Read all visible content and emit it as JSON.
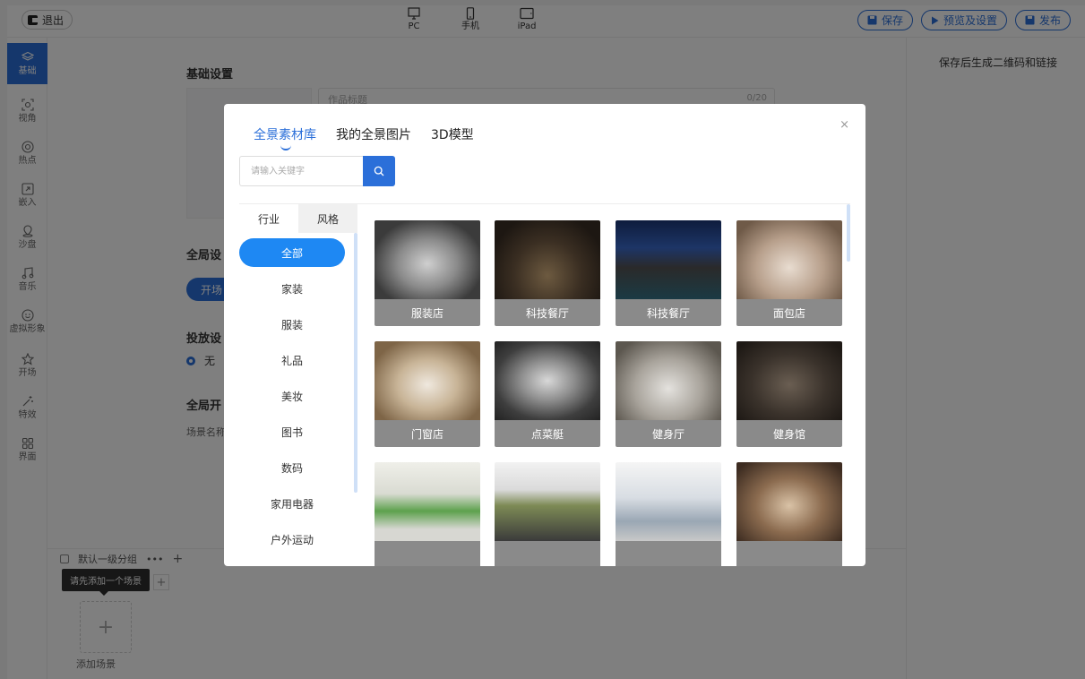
{
  "topbar": {
    "exit_label": "退出",
    "devices": [
      {
        "label": "PC"
      },
      {
        "label": "手机"
      },
      {
        "label": "iPad"
      }
    ],
    "save_label": "保存",
    "preview_label": "预览及设置",
    "publish_label": "发布"
  },
  "sidebar": {
    "items": [
      {
        "label": "基础",
        "icon": "layers-icon"
      },
      {
        "label": "视角",
        "icon": "view-angle-icon"
      },
      {
        "label": "热点",
        "icon": "hotspot-icon"
      },
      {
        "label": "嵌入",
        "icon": "embed-icon"
      },
      {
        "label": "沙盘",
        "icon": "map-pin-icon"
      },
      {
        "label": "音乐",
        "icon": "music-icon"
      },
      {
        "label": "虚拟形象",
        "icon": "avatar-icon"
      },
      {
        "label": "开场",
        "icon": "star-icon"
      },
      {
        "label": "特效",
        "icon": "magic-wand-icon"
      },
      {
        "label": "界面",
        "icon": "grid-icon"
      }
    ]
  },
  "main": {
    "basic_settings_title": "基础设置",
    "title_placeholder": "作品标题",
    "title_count": "0/20",
    "global_settings_title": "全局设",
    "open_button_label": "开场",
    "placement_title": "投放设",
    "radio_none_label": "无",
    "global_open_title": "全局开",
    "scene_name_label": "场景名称"
  },
  "right_panel": {
    "note": "保存后生成二维码和链接"
  },
  "bottom": {
    "group_name": "默认一级分组",
    "group_more": "•••",
    "group_add": "+",
    "tooltip": "请先添加一个场景",
    "tooltip_add": "+",
    "add_scene_plus": "+",
    "add_scene_label": "添加场景"
  },
  "modal": {
    "close": "×",
    "tabs": [
      {
        "label": "全景素材库",
        "active": true
      },
      {
        "label": "我的全景图片",
        "active": false
      },
      {
        "label": "3D模型",
        "active": false
      }
    ],
    "search_placeholder": "请输入关键字",
    "category_tabs": [
      {
        "label": "行业",
        "active": true
      },
      {
        "label": "风格",
        "active": false
      }
    ],
    "categories": [
      {
        "label": "全部",
        "active": true
      },
      {
        "label": "家装",
        "active": false
      },
      {
        "label": "服装",
        "active": false
      },
      {
        "label": "礼品",
        "active": false
      },
      {
        "label": "美妆",
        "active": false
      },
      {
        "label": "图书",
        "active": false
      },
      {
        "label": "数码",
        "active": false
      },
      {
        "label": "家用电器",
        "active": false
      },
      {
        "label": "户外运动",
        "active": false
      }
    ],
    "thumbnails": [
      {
        "label": "服装店"
      },
      {
        "label": "科技餐厅"
      },
      {
        "label": "科技餐厅"
      },
      {
        "label": "面包店"
      },
      {
        "label": "门窗店"
      },
      {
        "label": "点菜艇"
      },
      {
        "label": "健身厅"
      },
      {
        "label": "健身馆"
      },
      {
        "label": ""
      },
      {
        "label": ""
      },
      {
        "label": ""
      },
      {
        "label": ""
      }
    ]
  },
  "colors": {
    "accent": "#2b6fd9",
    "active_category": "#1e88f3",
    "overlay": "rgba(0,0,0,0.5)"
  }
}
